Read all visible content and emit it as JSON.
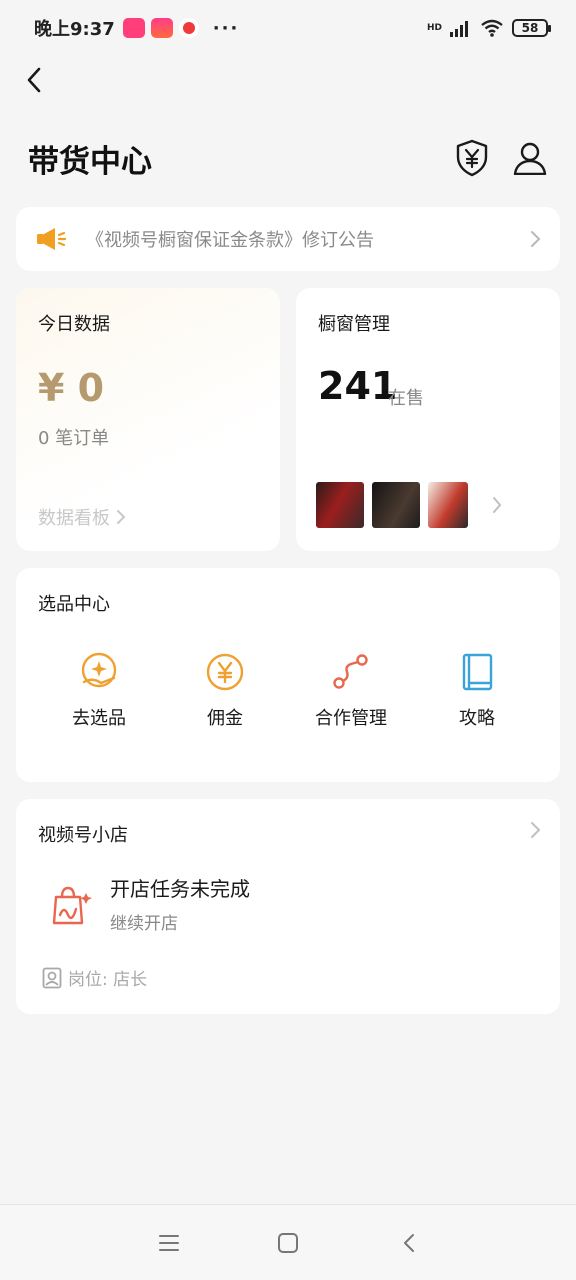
{
  "status_bar": {
    "time": "晚上9:37",
    "more": "···",
    "hd": "HD",
    "battery": "58"
  },
  "header": {
    "title": "带货中心"
  },
  "notice": {
    "text": "《视频号橱窗保证金条款》修订公告"
  },
  "today": {
    "title": "今日数据",
    "amount": "¥ 0",
    "orders": "0 笔订单",
    "dashboard_link": "数据看板"
  },
  "window": {
    "title": "橱窗管理",
    "count": "241",
    "unit": "在售"
  },
  "picker": {
    "title": "选品中心",
    "items": [
      {
        "label": "去选品",
        "icon": "select-product-icon"
      },
      {
        "label": "佣金",
        "icon": "commission-yen-icon"
      },
      {
        "label": "合作管理",
        "icon": "cooperation-icon"
      },
      {
        "label": "攻略",
        "icon": "guide-book-icon"
      }
    ]
  },
  "shop": {
    "title": "视频号小店",
    "task": "开店任务未完成",
    "continue": "继续开店",
    "role": "岗位: 店长"
  },
  "colors": {
    "accent_orange": "#f0a030",
    "gold": "#b49a6e",
    "coral": "#e8674e",
    "blue": "#3aa4d8"
  }
}
